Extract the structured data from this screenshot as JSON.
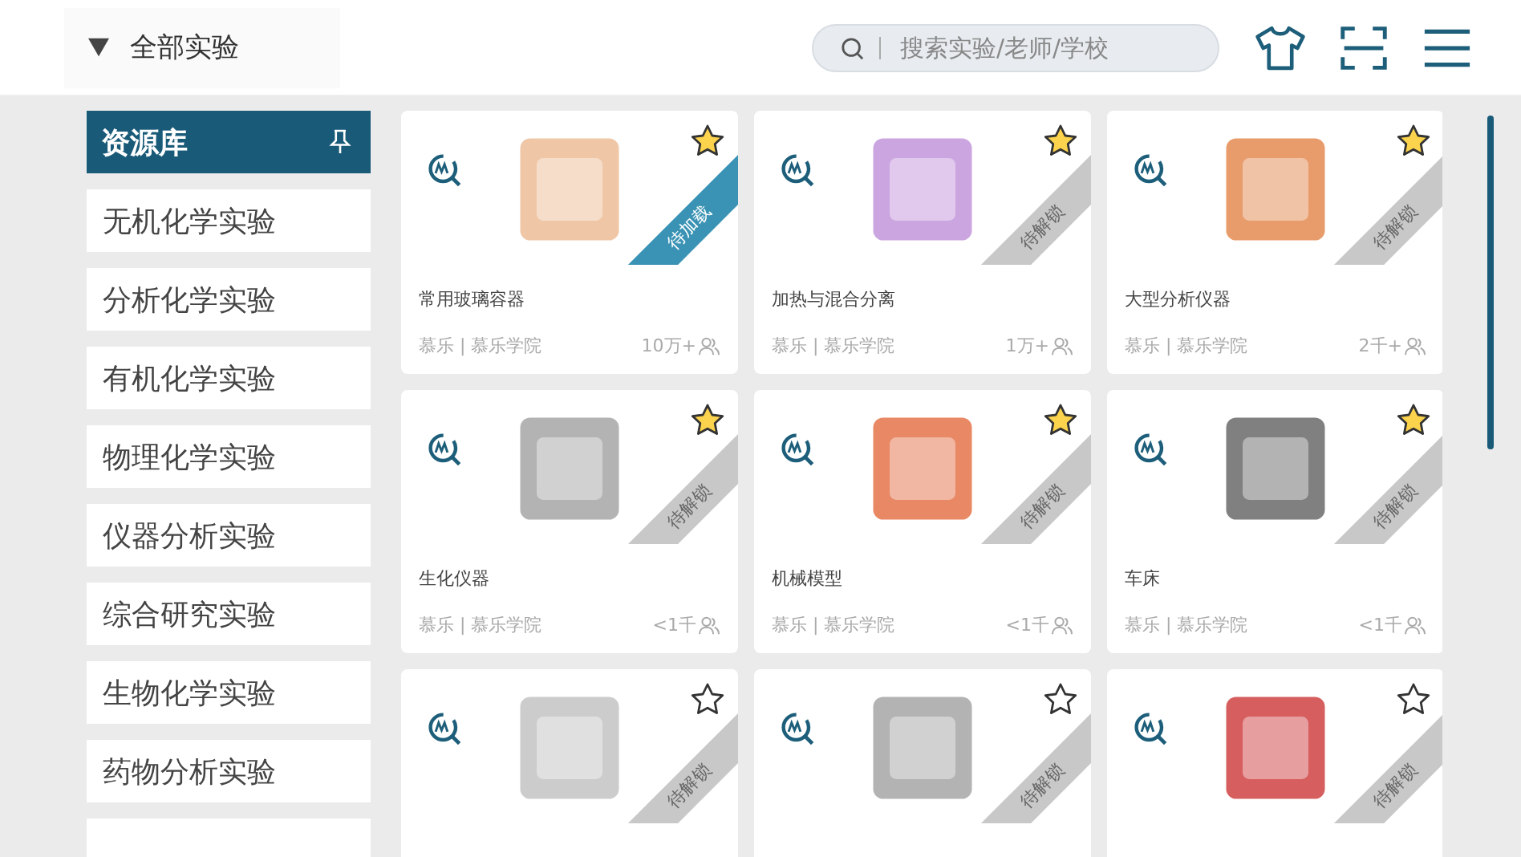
{
  "header": {
    "category_dropdown": "全部实验",
    "search": {
      "placeholder": "搜索实验/老师/学校"
    }
  },
  "sidebar": {
    "title": "资源库",
    "items": [
      {
        "label": "无机化学实验"
      },
      {
        "label": "分析化学实验"
      },
      {
        "label": "有机化学实验"
      },
      {
        "label": "物理化学实验"
      },
      {
        "label": "仪器分析实验"
      },
      {
        "label": "综合研究实验"
      },
      {
        "label": "生物化学实验"
      },
      {
        "label": "药物分析实验"
      }
    ]
  },
  "cards": [
    {
      "title": "常用玻璃容器",
      "author": "慕乐 | 慕乐学院",
      "users": "10万+",
      "favorited": true,
      "status": {
        "kind": "loading",
        "label": "待加载"
      }
    },
    {
      "title": "加热与混合分离",
      "author": "慕乐 | 慕乐学院",
      "users": "1万+",
      "favorited": true,
      "status": {
        "kind": "locked",
        "label": "待解锁"
      }
    },
    {
      "title": "大型分析仪器",
      "author": "慕乐 | 慕乐学院",
      "users": "2千+",
      "favorited": true,
      "status": {
        "kind": "locked",
        "label": "待解锁"
      }
    },
    {
      "title": "生化仪器",
      "author": "慕乐 | 慕乐学院",
      "users": "<1千",
      "favorited": true,
      "status": {
        "kind": "locked",
        "label": "待解锁"
      }
    },
    {
      "title": "机械模型",
      "author": "慕乐 | 慕乐学院",
      "users": "<1千",
      "favorited": true,
      "status": {
        "kind": "locked",
        "label": "待解锁"
      }
    },
    {
      "title": "车床",
      "author": "慕乐 | 慕乐学院",
      "users": "<1千",
      "favorited": true,
      "status": {
        "kind": "locked",
        "label": "待解锁"
      }
    },
    {
      "favorited": false,
      "status": {
        "kind": "locked",
        "label": "待解锁"
      }
    },
    {
      "favorited": false,
      "status": {
        "kind": "locked",
        "label": "待解锁"
      }
    },
    {
      "favorited": false,
      "status": {
        "kind": "locked",
        "label": "待解锁"
      }
    }
  ]
}
